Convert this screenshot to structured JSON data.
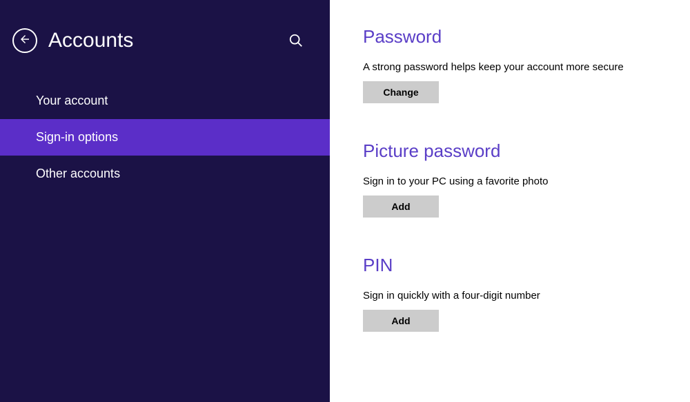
{
  "header": {
    "title": "Accounts"
  },
  "sidebar": {
    "items": [
      {
        "label": "Your account"
      },
      {
        "label": "Sign-in options"
      },
      {
        "label": "Other accounts"
      }
    ],
    "selectedIndex": 1
  },
  "sections": {
    "password": {
      "title": "Password",
      "description": "A strong password helps keep your account more secure",
      "button": "Change"
    },
    "picture": {
      "title": "Picture password",
      "description": "Sign in to your PC using a favorite photo",
      "button": "Add"
    },
    "pin": {
      "title": "PIN",
      "description": "Sign in quickly with a four-digit number",
      "button": "Add"
    }
  },
  "colors": {
    "sidebarBg": "#1b1246",
    "selectedBg": "#5b2ec8",
    "accent": "#5a3ec7",
    "buttonBg": "#cccccc"
  }
}
